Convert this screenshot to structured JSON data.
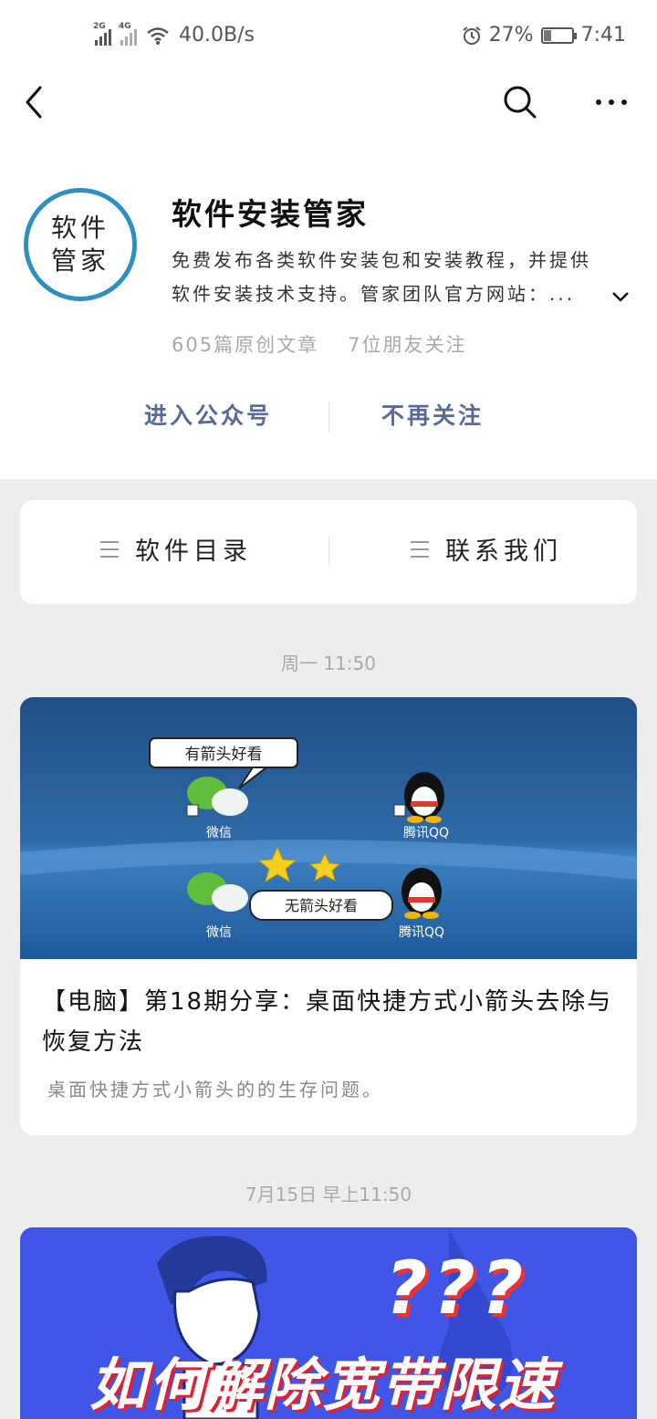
{
  "status_bar": {
    "network_1": "2G",
    "network_2": "4G",
    "speed": "40.0B/s",
    "battery": "27%",
    "battery_level": 0.27,
    "time": "7:41"
  },
  "account": {
    "avatar_line1": "软件",
    "avatar_line2": "管家",
    "name": "软件安装管家",
    "desc_line1": "免费发布各类软件安装包和安装教程，并提供",
    "desc_line2": "软件安装技术支持。管家团队官方网站：...",
    "articles": "605篇原创文章",
    "friends": "7位朋友关注",
    "enter_button": "进入公众号",
    "unfollow_button": "不再关注"
  },
  "menu": {
    "item1": "软件目录",
    "item2": "联系我们"
  },
  "feed": [
    {
      "time": "周一 11:50",
      "title": "【电脑】第18期分享：桌面快捷方式小箭头去除与恢复方法",
      "summary": "桌面快捷方式小箭头的的生存问题。",
      "image": {
        "bubble_top": "有箭头好看",
        "bubble_bottom": "无箭头好看",
        "label_wechat": "微信",
        "label_qq": "腾讯QQ"
      }
    },
    {
      "time": "7月15日 早上11:50",
      "image_text": "如何解除宽带限速",
      "image_qmarks": "???"
    }
  ],
  "colors": {
    "link_blue": "#576b95",
    "avatar_ring": "#2f8fc0",
    "banner_blue": "#3f56e6"
  }
}
